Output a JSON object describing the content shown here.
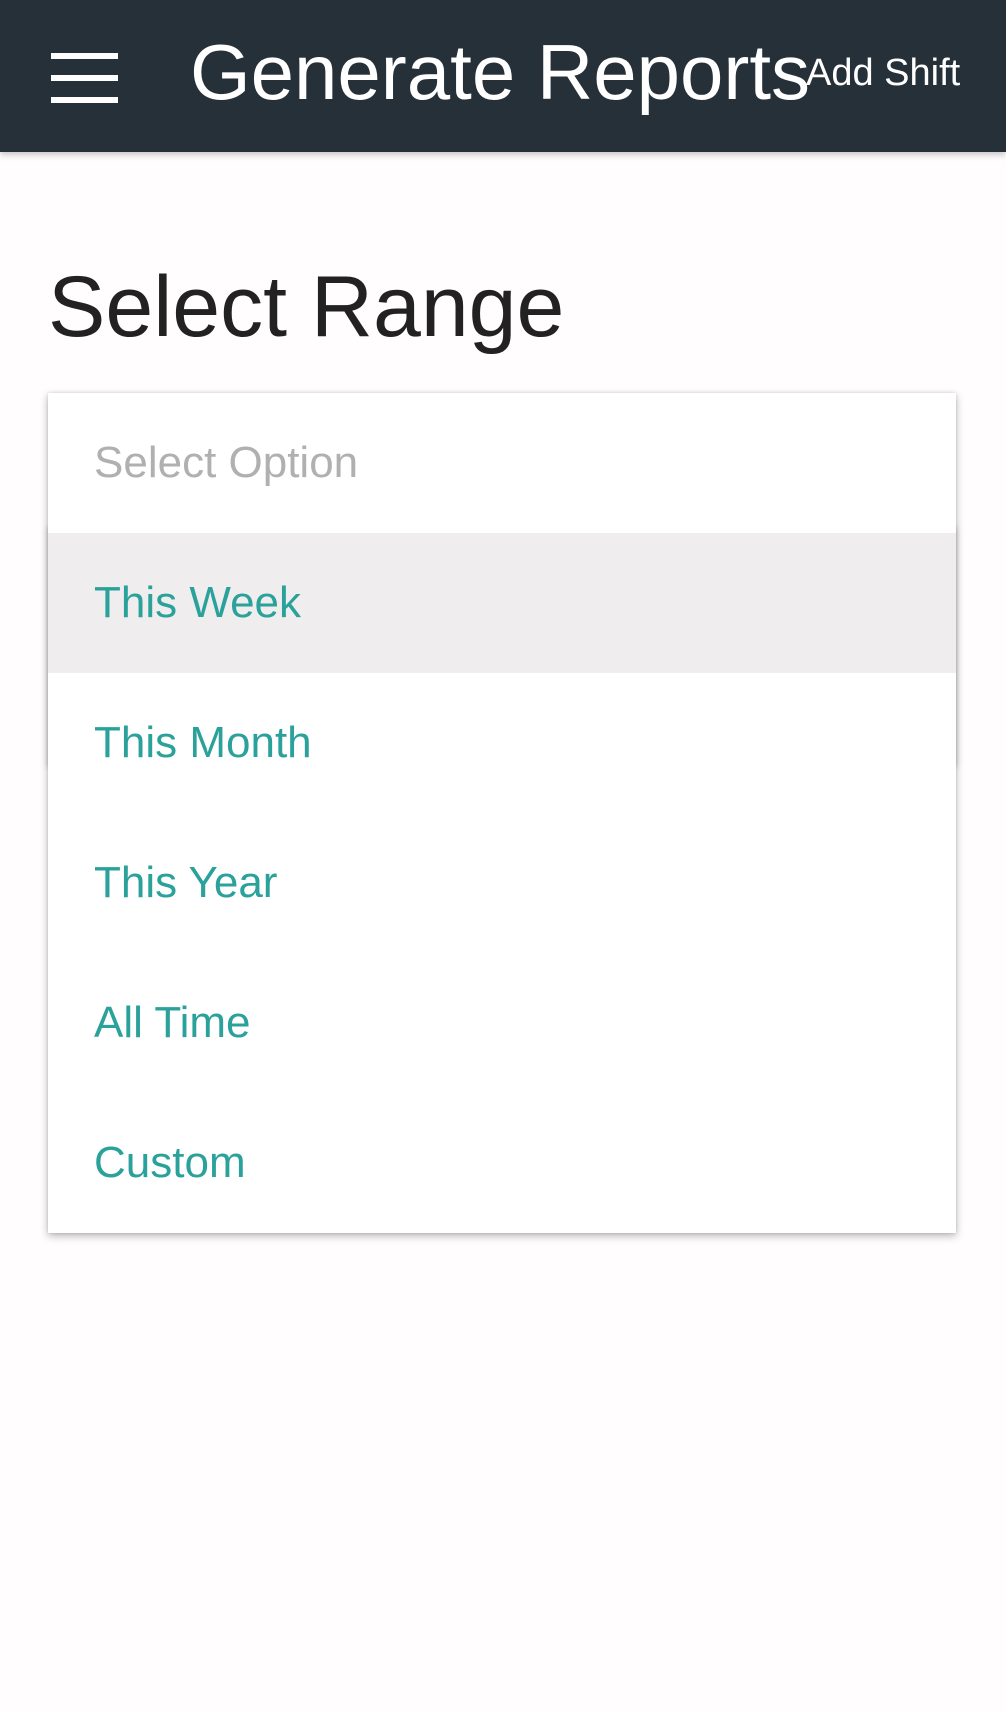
{
  "app_bar": {
    "menu_icon": "hamburger-menu-icon",
    "title": "Generate Reports",
    "action_label": "Add Shift",
    "background_color": "#263039"
  },
  "section": {
    "title": "Select Range"
  },
  "dropdown": {
    "placeholder": "Select Option",
    "highlighted_index": 0,
    "options": [
      {
        "label": "This Week"
      },
      {
        "label": "This Month"
      },
      {
        "label": "This Year"
      },
      {
        "label": "All Time"
      },
      {
        "label": "Custom"
      }
    ],
    "option_color": "#2aa19a",
    "placeholder_color": "#b0b0b0",
    "highlight_color": "#efedee"
  }
}
